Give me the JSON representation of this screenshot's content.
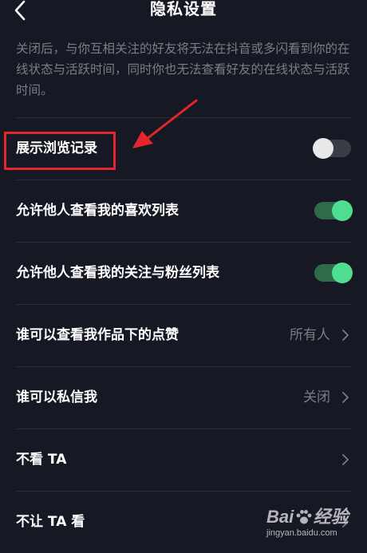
{
  "header": {
    "title": "隐私设置"
  },
  "description": "关闭后，与你互相关注的好友将无法在抖音或多闪看到你的在线状态与活跃时间，同时你也无法查看好友的在线状态与活跃时间。",
  "rows": [
    {
      "label": "展示浏览记录",
      "type": "toggle",
      "checked": false
    },
    {
      "label": "允许他人查看我的喜欢列表",
      "type": "toggle",
      "checked": true
    },
    {
      "label": "允许他人查看我的关注与粉丝列表",
      "type": "toggle",
      "checked": true
    },
    {
      "label": "谁可以查看我作品下的点赞",
      "type": "nav",
      "value": "所有人"
    },
    {
      "label": "谁可以私信我",
      "type": "nav",
      "value": "关闭"
    },
    {
      "label": "不看 TA",
      "type": "nav",
      "value": ""
    },
    {
      "label": "不让 TA 看",
      "type": "nav",
      "value": ""
    }
  ],
  "annotation": {
    "box_color": "#e5252c",
    "arrow_color": "#e5252c"
  },
  "watermark": {
    "logo": "Bai 经验",
    "site": "jingyan.baidu.com"
  },
  "colors": {
    "background": "#161823",
    "toggle_on": "#4fde90",
    "toggle_off_knob": "#e8e8ea",
    "secondary_text": "#7b7c84"
  }
}
